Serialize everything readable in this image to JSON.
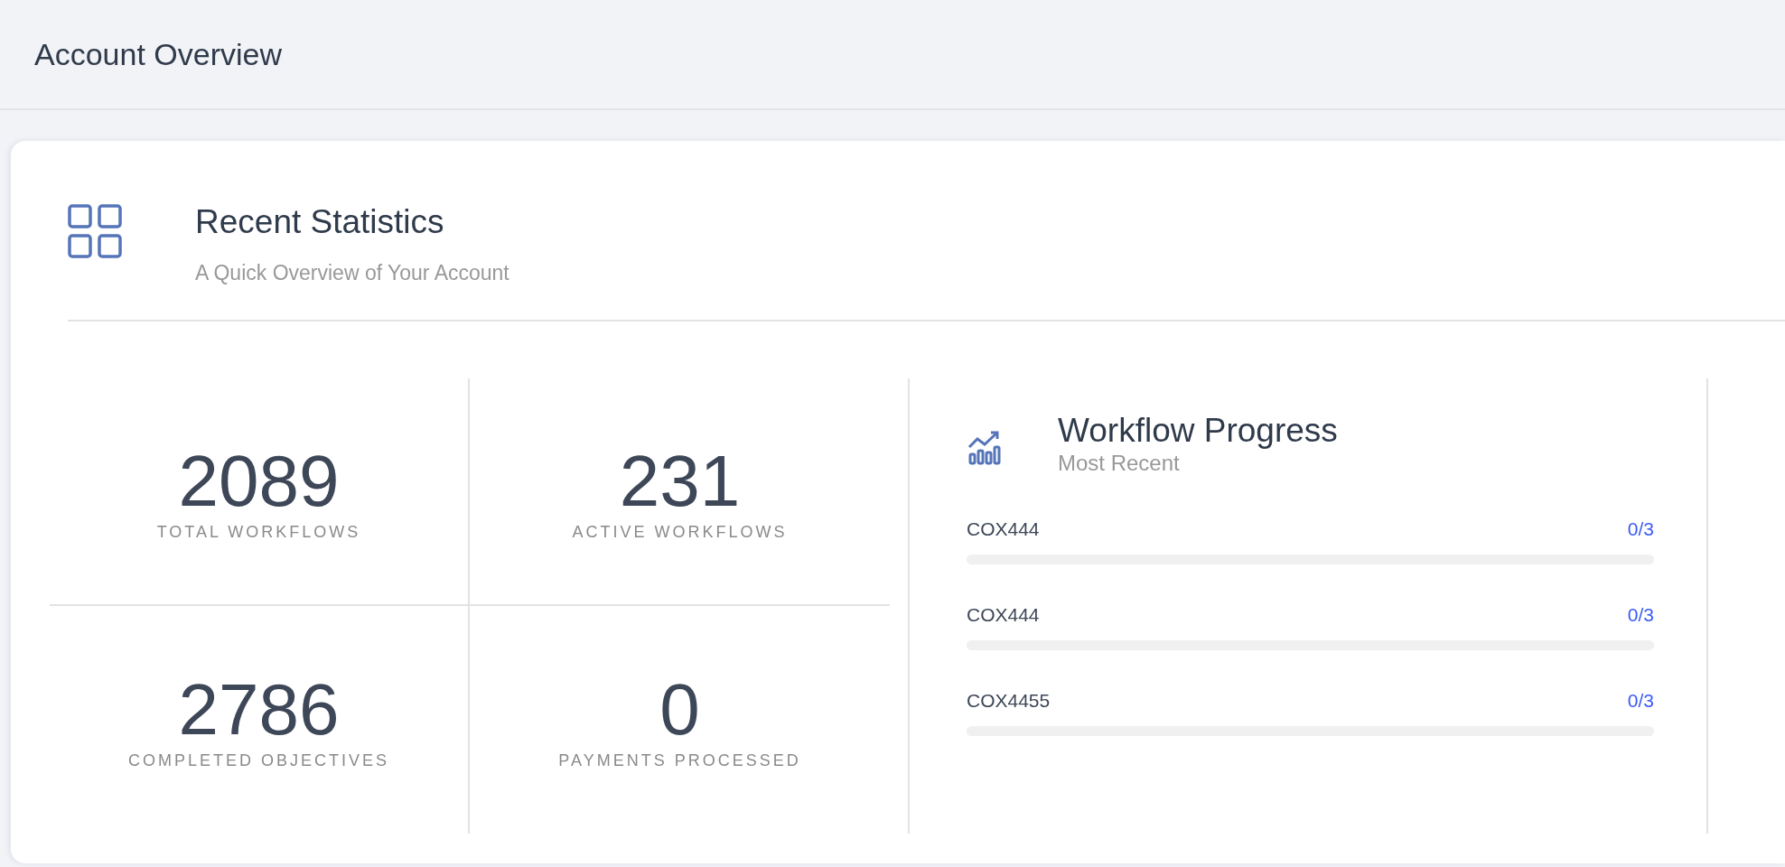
{
  "header": {
    "title": "Account Overview"
  },
  "card": {
    "title": "Recent Statistics",
    "subtitle": "A Quick Overview of Your Account"
  },
  "stats": [
    {
      "value": "2089",
      "label": "TOTAL WORKFLOWS"
    },
    {
      "value": "231",
      "label": "ACTIVE WORKFLOWS"
    },
    {
      "value": "2786",
      "label": "COMPLETED OBJECTIVES"
    },
    {
      "value": "0",
      "label": "PAYMENTS PROCESSED"
    }
  ],
  "progress": {
    "title": "Workflow Progress",
    "subtitle": "Most Recent",
    "items": [
      {
        "name": "COX444",
        "count": "0/3",
        "level": 0
      },
      {
        "name": "COX444",
        "count": "0/3",
        "level": 0
      },
      {
        "name": "COX4455",
        "count": "0/3",
        "level": 0
      }
    ]
  }
}
